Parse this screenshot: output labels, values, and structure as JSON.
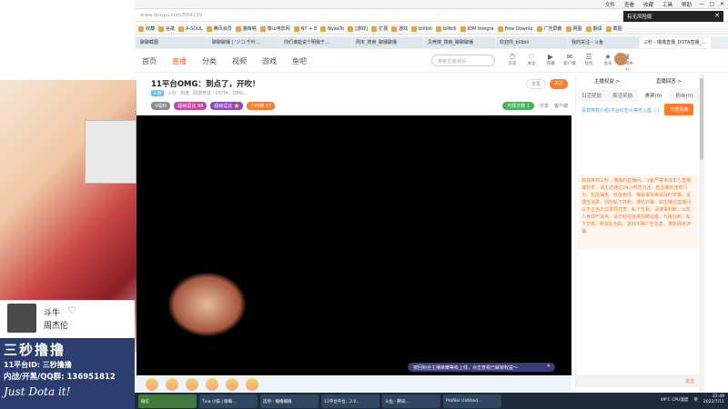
{
  "browser": {
    "address_text": "www.douyu.com/584239",
    "menu": [
      "文件",
      "查看",
      "收藏",
      "工具",
      "帮助"
    ],
    "window_buttons": [
      "—",
      "□",
      "✕"
    ],
    "notice": "有无风险版",
    "bookmarks": [
      "收藏",
      "谷歌",
      "A-SOUL",
      "腾讯会员",
      "猫粮喵",
      "泰山电影网",
      "NT + 8",
      "NyaaTo",
      "[游戏]",
      "扩展",
      "游戏",
      "bilibili",
      "bilibili",
      "IDM Integra",
      "Free Downlo",
      "广告屏蔽",
      "网图",
      "翻译",
      "截图"
    ],
    "tabs": [
      "聊聊截图",
      "聊聊聊播 | 'ツコ 千叶…",
      "你们谁能说个明我于…",
      "周末_搜索_聊播聊播",
      "贝壳搜_搜索_聊聊聊播",
      "欢迎你_bilibili",
      "我的关注 - 斗鱼",
      "三秒 - 撸撸直播_DOTA直播_D…"
    ]
  },
  "site_nav": {
    "items": [
      "首页",
      "直播",
      "分类",
      "视频",
      "游戏",
      "鱼吧"
    ],
    "active": "直播",
    "search_placeholder": "搜索主播/房间",
    "icons": [
      {
        "name": "history-icon",
        "glyph": "⏱",
        "label": "历史"
      },
      {
        "name": "follow-icon",
        "glyph": "♡",
        "label": "关注"
      },
      {
        "name": "live-icon",
        "glyph": "▶",
        "label": "开播"
      },
      {
        "name": "message-icon",
        "glyph": "✉",
        "label": "客户端"
      },
      {
        "name": "task-icon",
        "glyph": "☰",
        "label": "任务"
      },
      {
        "name": "vip-icon",
        "glyph": "★",
        "label": "会员"
      },
      {
        "name": "game-icon",
        "glyph": "♛",
        "label": "游戏中心"
      }
    ]
  },
  "room": {
    "title": "11平台OMG：到点了，开吹！",
    "tag1": "举报",
    "meta_category": "网游竞技 · DOTA · OMG...",
    "level": "三秒",
    "streamer": "三秒",
    "hot": "热度",
    "badges": [
      {
        "label": "V福利",
        "color": "#8a8a8a"
      },
      {
        "label": "超级逗比 98",
        "color": "#c14aa0"
      },
      {
        "label": "超级逗比 ⭐",
        "color": "#8a4ac1"
      },
      {
        "label": "小时榜 27",
        "color": "#ff7a2c"
      }
    ],
    "report": "举报",
    "follow": "关注",
    "gift_btn": "可领次数 1",
    "share": "分享",
    "client": "客户端"
  },
  "video": {
    "promo_text": "按回粉丝主播荣耀等级上线，点击查看已解锁权益～",
    "promo_close": "✕"
  },
  "sidebar": {
    "top": [
      "主播权益 >",
      "直播回答 >"
    ],
    "tabs": [
      "日活奖励",
      "周活奖励",
      "贵宾(0)",
      "粉丝(0)"
    ],
    "active_tab": "贵宾(0)",
    "link": "贵宾特权介绍(平台红包火等可入座 ⓘ)",
    "open_button": "开通贵族",
    "notice": "欢迎来到三秒 - 撸撸的直播间。斗鱼严禁未成年人直播或打赏，请主动通过24小时防沉迷，若主播有违规行为，包括抽奖、低俗色情、侮辱谩骂等请及时举报。请理性消费，切勿私下转账，谨防诈骗，如主播在直播间以不正当方式诱导打赏、私下交易，请谨慎判断，以防人身财产损失。请勿轻信各类招聘征婚、代练代刷、私下交易、购买礼包码、游戏币等广告信息，谨防网络诈骗。",
    "chat_hint": "发送"
  },
  "music": {
    "title": "斗牛",
    "artist": "周杰伦",
    "heart": "♡"
  },
  "banner": {
    "line1": "三秒撸撸",
    "line2": "11平台ID: 三秒撸撸",
    "line3": "内战/开黑/QQ群: 136951812",
    "line4": "Just Dota it!"
  },
  "taskbar": {
    "tasks": [
      "微信",
      "Tina 小猫 | 聊聊…",
      "选项 - 撸撸播播",
      "11平台平台…2.0…",
      "斗鱼 - 腾讯…",
      "Profiler Untitled…"
    ],
    "cpu": "CPU温度",
    "cpu_value": "49°C",
    "time": "22:49",
    "date": "2022/7/11",
    "input_method": "英"
  },
  "colors": {
    "brand_orange": "#ff7a2c",
    "nav_active": "#ff5d23"
  }
}
